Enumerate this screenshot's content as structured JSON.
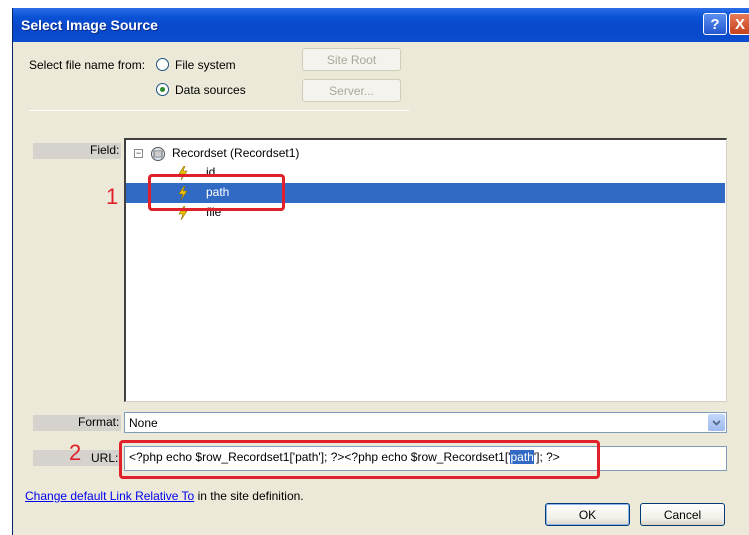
{
  "window": {
    "title": "Select Image Source",
    "help_label": "?",
    "close_label": "X"
  },
  "source": {
    "prompt": "Select file name from:",
    "options": [
      {
        "label": "File system",
        "checked": false
      },
      {
        "label": "Data sources",
        "checked": true
      }
    ],
    "site_root_label": "Site Root",
    "server_label": "Server..."
  },
  "field": {
    "label": "Field:",
    "tree": {
      "root": {
        "expander": "−",
        "label": "Recordset (Recordset1)"
      },
      "children": [
        {
          "label": "id",
          "selected": false
        },
        {
          "label": "path",
          "selected": true
        },
        {
          "label": "file",
          "selected": false
        }
      ]
    }
  },
  "format": {
    "label": "Format:",
    "value": "None"
  },
  "url": {
    "label": "URL:",
    "value_before": "<?php echo $row_Recordset1['path']; ?><?php echo $row_Recordset1['",
    "value_highlight": "path",
    "value_after": "']; ?>"
  },
  "footer": {
    "link_text": "Change default Link Relative To",
    "suffix_text": " in the site definition.",
    "ok_label": "OK",
    "cancel_label": "Cancel"
  },
  "annotations": {
    "marker_1": "1",
    "marker_2": "2",
    "color": "#e0202a"
  },
  "colors": {
    "selection": "#316ac5",
    "titlebar": "#0b52d6",
    "dialog_bg": "#ece9d8"
  }
}
